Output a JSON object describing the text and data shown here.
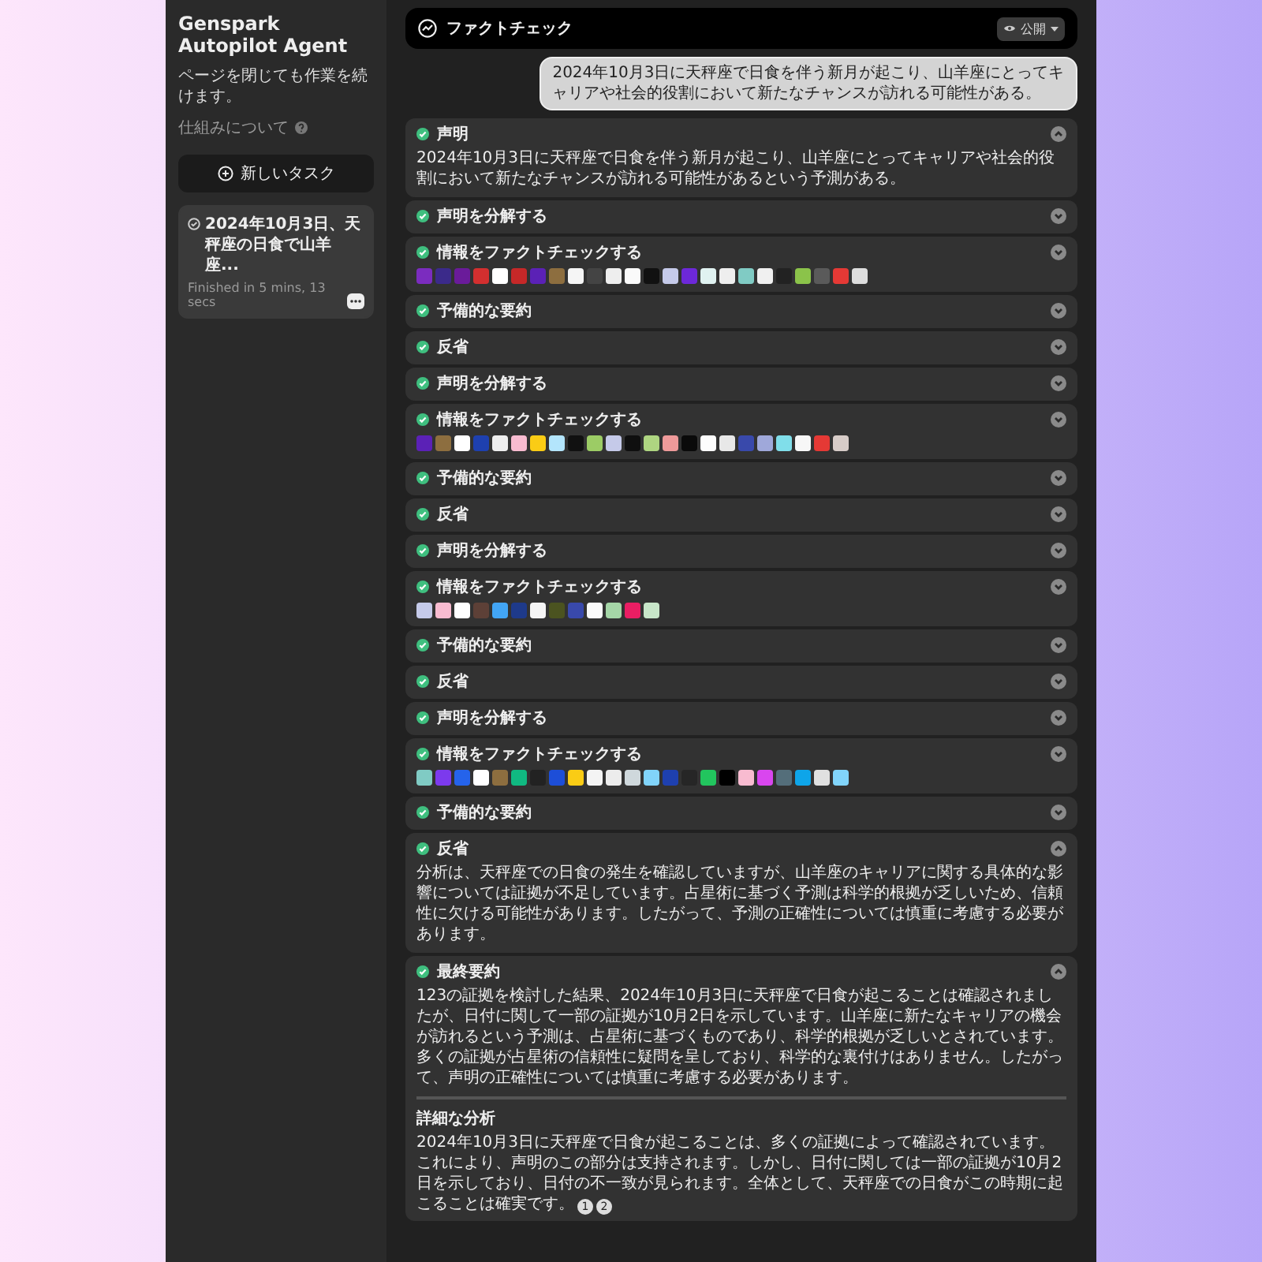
{
  "sidebar": {
    "title": "Genspark Autopilot Agent",
    "subtitle": "ページを閉じても作業を続けます。",
    "help_link": "仕組みについて",
    "new_task_button": "新しいタスク",
    "tasks": [
      {
        "title": "2024年10月3日、天秤座の日食で山羊座...",
        "meta": "Finished in 5 mins, 13 secs",
        "selected": true
      }
    ]
  },
  "header": {
    "title": "ファクトチェック",
    "visibility": "公開"
  },
  "user_message": "2024年10月3日に天秤座で日食を伴う新月が起こり、山羊座にとってキャリアや社会的役割において新たなチャンスが訪れる可能性がある。",
  "steps": [
    {
      "kind": "text",
      "title": "声明",
      "done": true,
      "expanded": true,
      "body": "2024年10月3日に天秤座で日食を伴う新月が起こり、山羊座にとってキャリアや社会的役割において新たなチャンスが訪れる可能性があるという予測がある。"
    },
    {
      "kind": "plain",
      "title": "声明を分解する",
      "done": true,
      "expanded": false
    },
    {
      "kind": "sources",
      "title": "情報をファクトチェックする",
      "done": true,
      "expanded": false,
      "sources": [
        {
          "color": "#7b2cbf"
        },
        {
          "color": "#3b2a8a"
        },
        {
          "color": "#6a1b9a"
        },
        {
          "color": "#d32f2f"
        },
        {
          "color": "#ffffff"
        },
        {
          "color": "#c62828"
        },
        {
          "color": "#5b21b6"
        },
        {
          "color": "#8d6e3f"
        },
        {
          "color": "#f5f5f5"
        },
        {
          "color": "#444444"
        },
        {
          "color": "#eeeeee"
        },
        {
          "color": "#fafafa"
        },
        {
          "color": "#111111"
        },
        {
          "color": "#c5cae9"
        },
        {
          "color": "#6d28d9"
        },
        {
          "color": "#e0f2f1"
        },
        {
          "color": "#eeeeee"
        },
        {
          "color": "#80cbc4"
        },
        {
          "color": "#f0f0f0"
        },
        {
          "color": "#222222"
        },
        {
          "color": "#8bc34a"
        },
        {
          "color": "#5a5a5a"
        },
        {
          "color": "#e53935"
        },
        {
          "color": "#dddddd"
        }
      ]
    },
    {
      "kind": "plain",
      "title": "予備的な要約",
      "done": true,
      "expanded": false
    },
    {
      "kind": "plain",
      "title": "反省",
      "done": true,
      "expanded": false
    },
    {
      "kind": "plain",
      "title": "声明を分解する",
      "done": true,
      "expanded": false
    },
    {
      "kind": "sources",
      "title": "情報をファクトチェックする",
      "done": true,
      "expanded": false,
      "sources": [
        {
          "color": "#5b21b6"
        },
        {
          "color": "#8d6e3f"
        },
        {
          "color": "#ffffff"
        },
        {
          "color": "#1e40af"
        },
        {
          "color": "#eeeeee"
        },
        {
          "color": "#f8bbd0"
        },
        {
          "color": "#facc15"
        },
        {
          "color": "#b3e5fc"
        },
        {
          "color": "#111111"
        },
        {
          "color": "#9ccc65"
        },
        {
          "color": "#c5cae9"
        },
        {
          "color": "#0f0f0f"
        },
        {
          "color": "#aed581"
        },
        {
          "color": "#ef9a9a"
        },
        {
          "color": "#0a0a0a"
        },
        {
          "color": "#fdfdfd"
        },
        {
          "color": "#e8e8e8"
        },
        {
          "color": "#3949ab"
        },
        {
          "color": "#9fa8da"
        },
        {
          "color": "#80deea"
        },
        {
          "color": "#f7f7f7"
        },
        {
          "color": "#e53935"
        },
        {
          "color": "#d7ccc8"
        }
      ]
    },
    {
      "kind": "plain",
      "title": "予備的な要約",
      "done": true,
      "expanded": false
    },
    {
      "kind": "plain",
      "title": "反省",
      "done": true,
      "expanded": false
    },
    {
      "kind": "plain",
      "title": "声明を分解する",
      "done": true,
      "expanded": false
    },
    {
      "kind": "sources",
      "title": "情報をファクトチェックする",
      "done": true,
      "expanded": false,
      "sources": [
        {
          "color": "#c5cae9"
        },
        {
          "color": "#f8bbd0"
        },
        {
          "color": "#ffffff"
        },
        {
          "color": "#5d4037"
        },
        {
          "color": "#42a5f5"
        },
        {
          "color": "#1e3a8a"
        },
        {
          "color": "#f5f5f5"
        },
        {
          "color": "#4b5320"
        },
        {
          "color": "#3949ab"
        },
        {
          "color": "#fafafa"
        },
        {
          "color": "#a5d6a7"
        },
        {
          "color": "#e91e63"
        },
        {
          "color": "#c8e6c9"
        }
      ]
    },
    {
      "kind": "plain",
      "title": "予備的な要約",
      "done": true,
      "expanded": false
    },
    {
      "kind": "plain",
      "title": "反省",
      "done": true,
      "expanded": false
    },
    {
      "kind": "plain",
      "title": "声明を分解する",
      "done": true,
      "expanded": false
    },
    {
      "kind": "sources",
      "title": "情報をファクトチェックする",
      "done": true,
      "expanded": false,
      "sources": [
        {
          "color": "#80cbc4"
        },
        {
          "color": "#7c3aed"
        },
        {
          "color": "#2563eb"
        },
        {
          "color": "#ffffff"
        },
        {
          "color": "#8d6e3f"
        },
        {
          "color": "#10b981"
        },
        {
          "color": "#222222"
        },
        {
          "color": "#1d4ed8"
        },
        {
          "color": "#facc15"
        },
        {
          "color": "#f4f4f4"
        },
        {
          "color": "#ececec"
        },
        {
          "color": "#cfd8dc"
        },
        {
          "color": "#81d4fa"
        },
        {
          "color": "#1e40af"
        },
        {
          "color": "#262626"
        },
        {
          "color": "#22c55e"
        },
        {
          "color": "#000000"
        },
        {
          "color": "#f8bbd0"
        },
        {
          "color": "#d946ef"
        },
        {
          "color": "#546e7a"
        },
        {
          "color": "#0ea5e9"
        },
        {
          "color": "#e0e0e0"
        },
        {
          "color": "#81d4fa"
        }
      ]
    },
    {
      "kind": "plain",
      "title": "予備的な要約",
      "done": true,
      "expanded": false
    },
    {
      "kind": "text",
      "title": "反省",
      "done": true,
      "expanded": true,
      "body": "分析は、天秤座での日食の発生を確認していますが、山羊座のキャリアに関する具体的な影響については証拠が不足しています。占星術に基づく予測は科学的根拠が乏しいため、信頼性に欠ける可能性があります。したがって、予測の正確性については慎重に考慮する必要があります。"
    },
    {
      "kind": "summary",
      "title": "最終要約",
      "done": true,
      "expanded": true,
      "body": "123の証拠を検討した結果、2024年10月3日に天秤座で日食が起こることは確認されましたが、日付に関して一部の証拠が10月2日を示しています。山羊座に新たなキャリアの機会が訪れるという予測は、占星術に基づくものであり、科学的根拠が乏しいとされています。多くの証拠が占星術の信頼性に疑問を呈しており、科学的な裏付けはありません。したがって、声明の正確性については慎重に考慮する必要があります。",
      "detail_heading": "詳細な分析",
      "detail": "2024年10月3日に天秤座で日食が起こることは、多くの証拠によって確認されています。これにより、声明のこの部分は支持されます。しかし、日付に関しては一部の証拠が10月2日を示しており、日付の不一致が見られます。全体として、天秤座での日食がこの時期に起こることは確実です。",
      "citations": [
        "1",
        "2"
      ]
    }
  ]
}
